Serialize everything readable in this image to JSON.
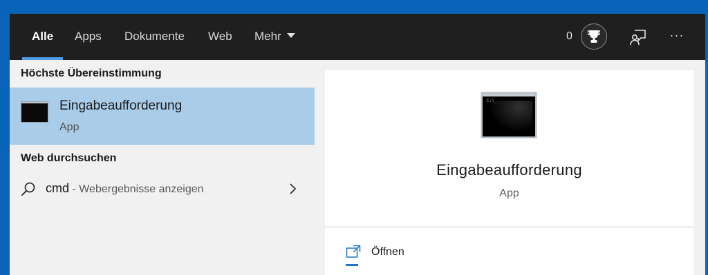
{
  "tabs": [
    {
      "label": "Alle",
      "active": true
    },
    {
      "label": "Apps",
      "active": false
    },
    {
      "label": "Dokumente",
      "active": false
    },
    {
      "label": "Web",
      "active": false
    },
    {
      "label": "Mehr",
      "active": false
    }
  ],
  "header": {
    "points": "0",
    "more_label": "···",
    "icons": [
      "trophy-icon",
      "feedback-icon",
      "more-icon"
    ]
  },
  "left": {
    "best_match_heading": "Höchste Übereinstimmung",
    "best_match": {
      "title": "Eingabeaufforderung",
      "subtitle": "App",
      "icon": "command-prompt-icon"
    },
    "web_heading": "Web durchsuchen",
    "web_result": {
      "query": "cmd",
      "hint": " - Webergebnisse anzeigen",
      "icon": "search-icon"
    }
  },
  "detail": {
    "title": "Eingabeaufforderung",
    "subtitle": "App",
    "prompt_text": "C:\\_",
    "actions": [
      {
        "label": "Öffnen",
        "icon": "open-icon"
      }
    ]
  },
  "colors": {
    "accent": "#4b9be6",
    "selection": "#a9cce9",
    "topbar": "#1f1f1f",
    "desktop": "#0863b8",
    "action_icon": "#1f74c6"
  }
}
